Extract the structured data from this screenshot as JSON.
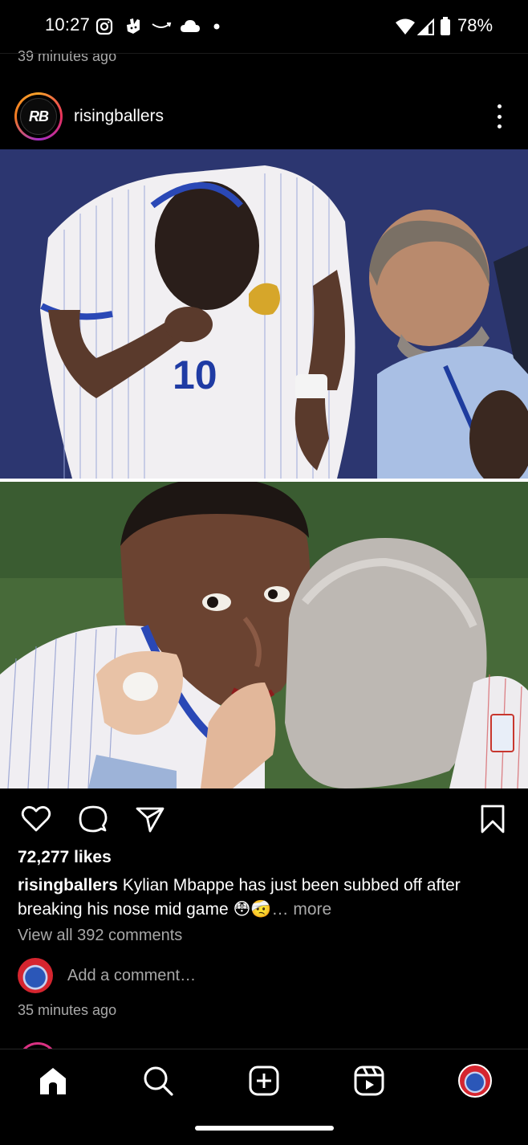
{
  "status_bar": {
    "time": "10:27",
    "battery_percent": "78%",
    "icons": [
      "instagram-icon",
      "deliveroo-icon",
      "amazon-icon",
      "cloud-icon",
      "dot-icon",
      "wifi-icon",
      "signal-icon",
      "battery-icon"
    ]
  },
  "previous_post": {
    "timestamp": "39 minutes ago"
  },
  "post": {
    "username": "risingballers",
    "avatar_text": "RB",
    "likes": "72,277 likes",
    "caption_user": "risingballers",
    "caption_text": "Kylian Mbappe has just been subbed off after breaking his nose mid game",
    "caption_emoji": "😳🤕",
    "caption_more": "… more",
    "view_comments": "View all 392 comments",
    "add_comment_placeholder": "Add a comment…",
    "timestamp": "35 minutes ago",
    "jersey_number": "10"
  },
  "actions": [
    "heart-icon",
    "comment-icon",
    "share-icon",
    "bookmark-icon"
  ],
  "nav": [
    "home-icon",
    "search-icon",
    "create-icon",
    "reels-icon",
    "profile-avatar"
  ],
  "colors": {
    "background": "#000000",
    "secondary_text": "#a8a8a8",
    "ring_accent": "#e7305c"
  }
}
